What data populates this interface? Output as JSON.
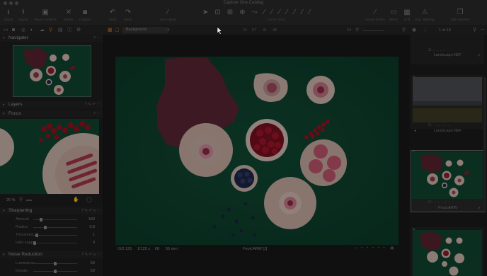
{
  "window": {
    "title": "Capture One Catalog"
  },
  "toolbar": {
    "import": "Import",
    "export": "Export",
    "move_to_selects": "Move to Selects",
    "delete": "Delete",
    "capture": "Capture",
    "undo": "Undo",
    "redo": "Redo",
    "auto_adjust": "Auto Adjust",
    "cursor_tools": "Cursor Tools",
    "instant_profile": "Instant Profile",
    "mirror": "Mirror",
    "grid": "Grid",
    "exp_warning": "Exp. Warning",
    "edit_selected": "Edit Selected"
  },
  "toolsbar": {
    "layer_select": "Background",
    "readout_r_label": "R:",
    "readout_r": "57",
    "readout_g": "41",
    "readout_b": "48",
    "fit": "Fit",
    "counter": "1 of 13"
  },
  "left": {
    "navigator": "Navigator",
    "layers": "Layers",
    "focus": "Focus",
    "focus_zoom": "25 %",
    "sharpening": "Sharpening",
    "sharpening_rows": [
      {
        "label": "Amount",
        "value": "180",
        "pos": 0.15
      },
      {
        "label": "Radius",
        "value": "0.8",
        "pos": 0.25
      },
      {
        "label": "Threshold",
        "value": "1",
        "pos": 0.05
      },
      {
        "label": "Halo suppr...",
        "value": "0",
        "pos": 0.0
      }
    ],
    "noise": "Noise Reduction",
    "noise_rows": [
      {
        "label": "Luminance",
        "value": "50",
        "pos": 0.5
      },
      {
        "label": "Details",
        "value": "50",
        "pos": 0.5
      }
    ]
  },
  "viewer": {
    "iso": "ISO 125",
    "shutter": "1/125 s",
    "aperture": "f/8",
    "focal": "55 mm",
    "filename": "Food.ARW [1]"
  },
  "browser": {
    "items": [
      {
        "label": "Landscape.NEF",
        "index": ""
      },
      {
        "label": "Landscape.NEF",
        "index": "2"
      },
      {
        "label": "Food.ARW",
        "index": "3"
      },
      {
        "label": "",
        "index": "4"
      }
    ],
    "stars": "• • • • •"
  },
  "colors": {
    "accent": "#c0772a",
    "backdrop": "#0f4430",
    "selected_border": "#6a6a6a"
  },
  "icons": {
    "import": "download-tray-icon",
    "export": "upload-tray-icon",
    "move": "stack-icon",
    "delete": "x-icon",
    "capture": "camera-icon",
    "undo": "undo-arrow-icon",
    "redo": "redo-arrow-icon",
    "auto": "magic-wand-icon",
    "instant": "eyedropper-icon",
    "mirror": "monitor-icon",
    "grid": "grid-icon",
    "warn": "warning-triangle-icon",
    "edit": "stacked-frames-icon"
  }
}
